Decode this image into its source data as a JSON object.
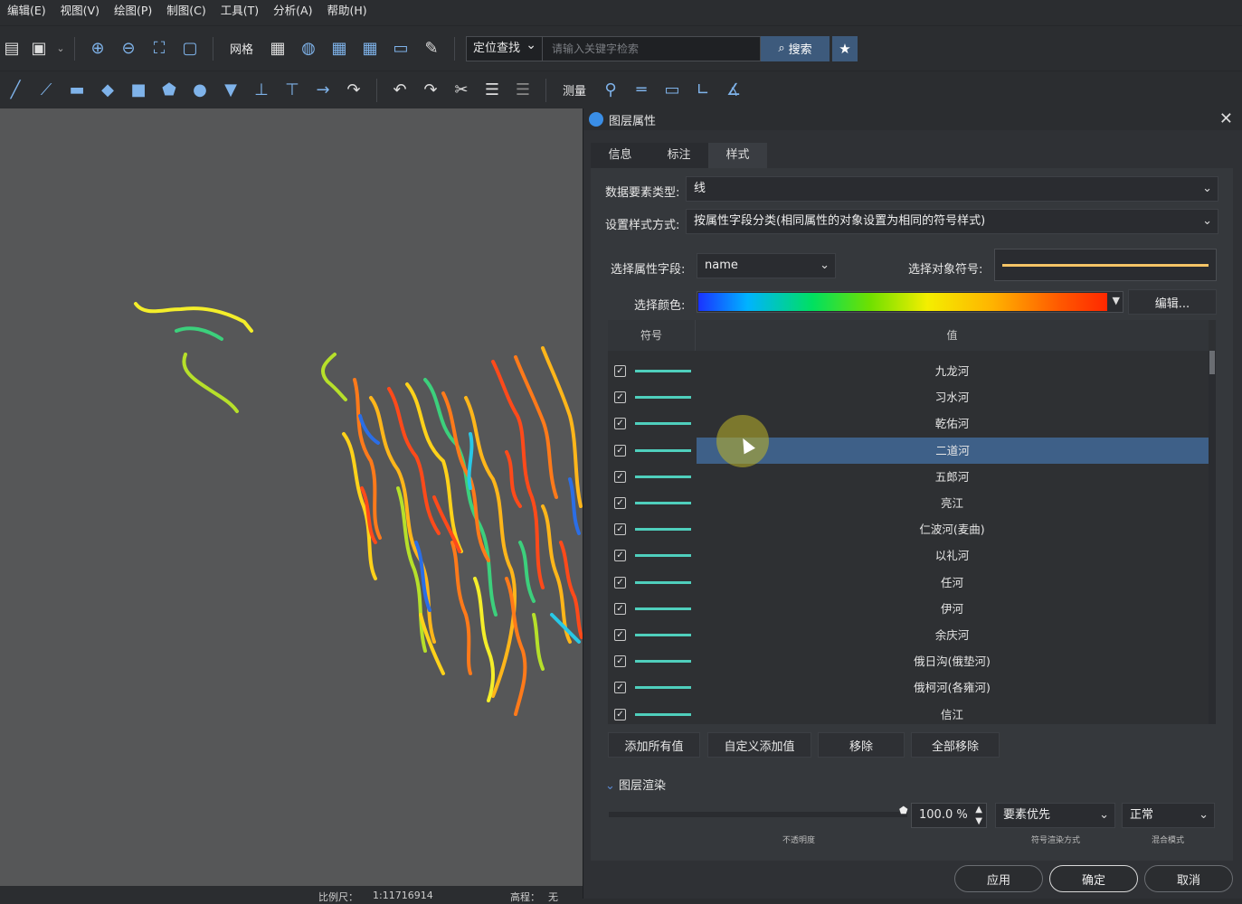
{
  "menubar": [
    "编辑(E)",
    "视图(V)",
    "绘图(P)",
    "制图(C)",
    "工具(T)",
    "分析(A)",
    "帮助(H)"
  ],
  "toolbar": {
    "grid_label": "网格",
    "locate_label": "定位查找",
    "search_placeholder": "请输入关键字检索",
    "search_button": "搜索",
    "measure_label": "测量"
  },
  "statusbar": {
    "scale_label": "比例尺：",
    "scale_value": "1:11716914",
    "elevation_label": "高程：",
    "elevation_value": "无"
  },
  "dialog": {
    "title": "图层属性",
    "tabs": [
      "信息",
      "标注",
      "样式"
    ],
    "active_tab": "样式",
    "data_type_label": "数据要素类型:",
    "data_type_value": "线",
    "style_mode_label": "设置样式方式:",
    "style_mode_value": "按属性字段分类(相同属性的对象设置为相同的符号样式)",
    "field_label": "选择属性字段:",
    "field_value": "name",
    "symbol_label": "选择对象符号:",
    "symbol_color": "#f5c466",
    "color_label": "选择颜色:",
    "edit_button": "编辑...",
    "table": {
      "headers": [
        "符号",
        "值"
      ],
      "rows": [
        "九龙河",
        "习水河",
        "乾佑河",
        "二道河",
        "五郎河",
        "亮江",
        "仁波河(麦曲)",
        "以礼河",
        "任河",
        "伊河",
        "余庆河",
        "俄日沟(俄垫河)",
        "俄柯河(各雍河)",
        "信江"
      ],
      "selected_index": 3,
      "line_color": "#4fcfbd"
    },
    "buttons": {
      "add_all": "添加所有值",
      "custom_add": "自定义添加值",
      "remove": "移除",
      "remove_all": "全部移除"
    },
    "render": {
      "section_title": "图层渲染",
      "opacity_value": "100.0 %",
      "opacity_label": "不透明度",
      "symbol_render_value": "要素优先",
      "symbol_render_label": "符号渲染方式",
      "blend_value": "正常",
      "blend_label": "混合模式"
    },
    "footer": {
      "apply": "应用",
      "ok": "确定",
      "cancel": "取消"
    }
  }
}
